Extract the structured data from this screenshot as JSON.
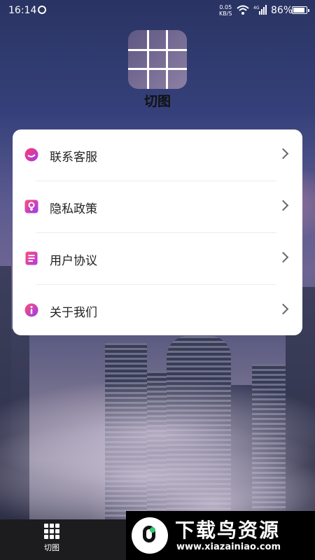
{
  "status_bar": {
    "time": "16:14",
    "net_speed_value": "0.05",
    "net_speed_unit": "KB/S",
    "signal_label": "4G",
    "battery": "86%"
  },
  "app": {
    "title": "切图"
  },
  "menu": {
    "items": [
      {
        "label": "联系客服",
        "icon": "customer-service-icon",
        "color": "#e0347a"
      },
      {
        "label": "隐私政策",
        "icon": "privacy-lock-icon",
        "color": "#c33bd8"
      },
      {
        "label": "用户协议",
        "icon": "document-list-icon",
        "color": "#e8427c"
      },
      {
        "label": "关于我们",
        "icon": "info-icon",
        "color": "#d7368e"
      }
    ]
  },
  "bottom_nav": {
    "items": [
      {
        "label": "切图",
        "icon": "grid-icon"
      }
    ]
  },
  "watermark": {
    "brand": "下载鸟资源",
    "domain": "www.xiazainiao.com"
  },
  "theme": {
    "accent_gradient": [
      "#ff4d7a",
      "#9b3cf0"
    ],
    "card_bg": "#ffffff",
    "nav_bg": "#1c1c1f"
  }
}
